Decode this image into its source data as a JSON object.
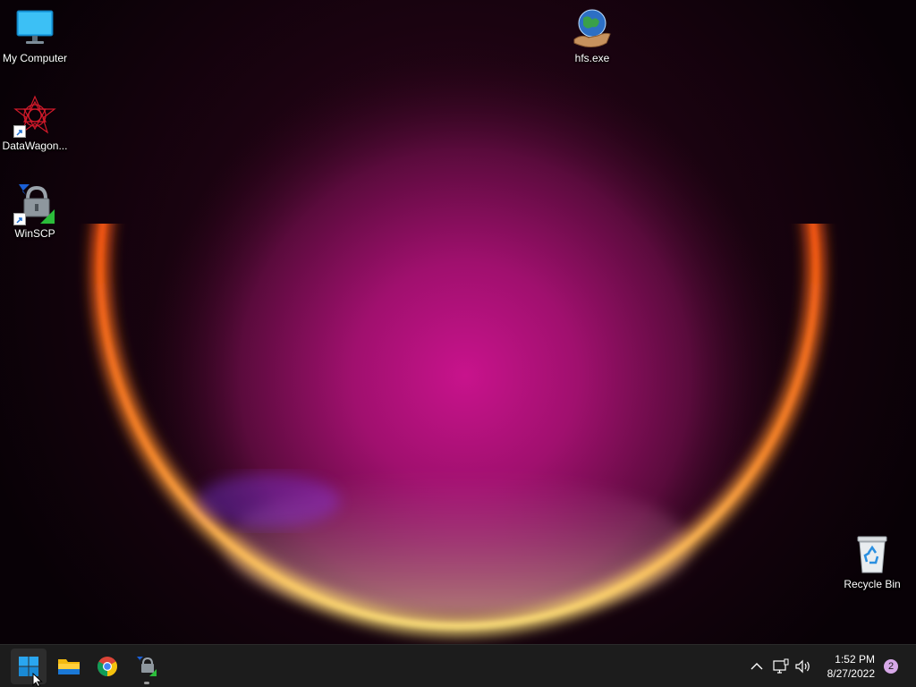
{
  "desktop": {
    "icons": [
      {
        "label": "My Computer",
        "icon": "monitor-icon"
      },
      {
        "label": "DataWagon...",
        "icon": "datawagon-icon"
      },
      {
        "label": "WinSCP",
        "icon": "winscp-icon"
      },
      {
        "label": "hfs.exe",
        "icon": "hfs-globe-icon"
      },
      {
        "label": "Recycle Bin",
        "icon": "recycle-bin-icon"
      }
    ],
    "wallpaper_colors": {
      "center": "#c0148a",
      "ring_orange": "#ff6a1a",
      "ring_yellow": "#ffe27a",
      "background": "#0b0208"
    }
  },
  "taskbar": {
    "pinned": [
      {
        "name": "Start",
        "icon": "windows-start-icon"
      },
      {
        "name": "File Explorer",
        "icon": "folder-icon"
      },
      {
        "name": "Google Chrome",
        "icon": "chrome-icon"
      },
      {
        "name": "WinSCP",
        "icon": "winscp-icon"
      }
    ],
    "tray": {
      "chevron": "chevron-up-icon",
      "network": "network-icon",
      "volume": "volume-icon"
    },
    "clock": {
      "time": "1:52 PM",
      "date": "8/27/2022"
    },
    "notification_count": "2",
    "background": "#1c1c1c"
  }
}
